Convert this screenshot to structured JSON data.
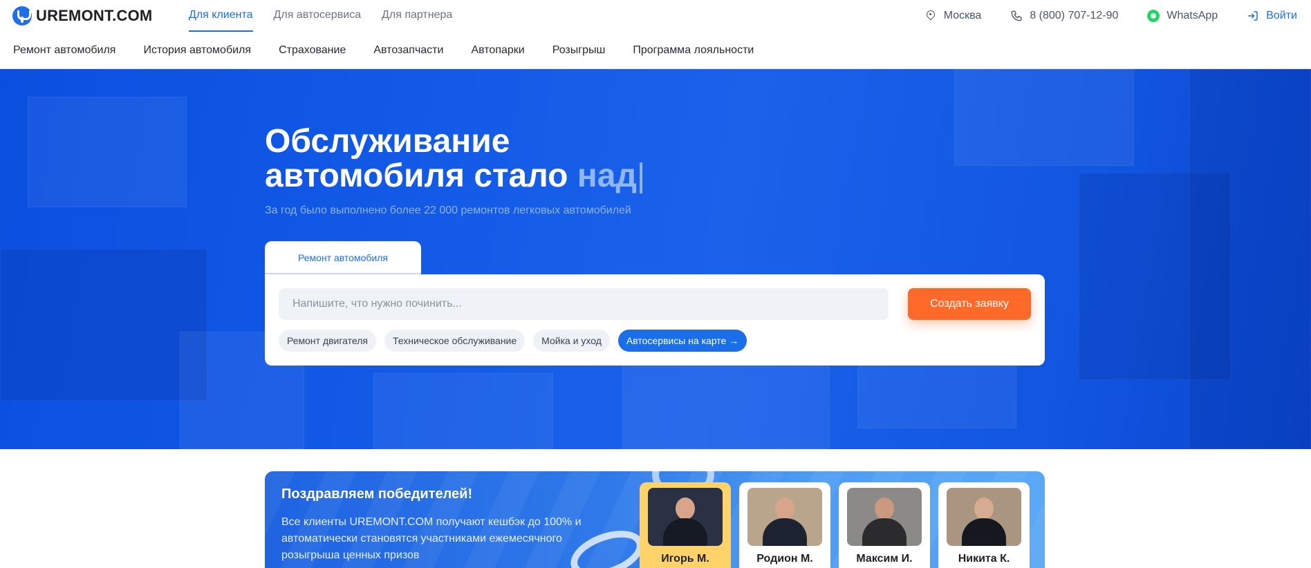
{
  "header": {
    "logo_text": "UREMONT.COM",
    "tabs": [
      {
        "label": "Для клиента",
        "active": true
      },
      {
        "label": "Для автосервиса",
        "active": false
      },
      {
        "label": "Для партнера",
        "active": false
      }
    ],
    "city": "Москва",
    "phone": "8 (800) 707-12-90",
    "whatsapp": "WhatsApp",
    "login": "Войти"
  },
  "subnav": {
    "items": [
      "Ремонт автомобиля",
      "История автомобиля",
      "Страхование",
      "Автозапчасти",
      "Автопарки",
      "Розыгрыш",
      "Программа лояльности"
    ]
  },
  "hero": {
    "title_line1": "Обслуживание",
    "title_line2": "автомобиля стало",
    "title_typing": "над",
    "caret": "|",
    "subtitle": "За год было выполнено более 22 000 ремонтов легковых автомобилей",
    "tab": "Ремонт автомобиля",
    "search_placeholder": "Напишите, что нужно починить...",
    "search_value": "",
    "create_button": "Создать заявку",
    "chips": [
      "Ремонт двигателя",
      "Техническое обслуживание",
      "Мойка и уход",
      "Автосервисы на карте →"
    ]
  },
  "winners": {
    "title": "Поздравляем победителей!",
    "text": "Все клиенты UREMONT.COM получают кешбэк до 100% и автоматически становятся участниками ежемесячного розыгрыша ценных призов",
    "people": [
      {
        "name": "Игорь М.",
        "highlight": true
      },
      {
        "name": "Родион М.",
        "highlight": false
      },
      {
        "name": "Максим И.",
        "highlight": false
      },
      {
        "name": "Никита К.",
        "highlight": false
      }
    ]
  },
  "colors": {
    "accent": "#1a6ee8",
    "cta": "#ff6a28",
    "hero_bg": "#1259e6",
    "winner_highlight": "#ffd36a"
  }
}
